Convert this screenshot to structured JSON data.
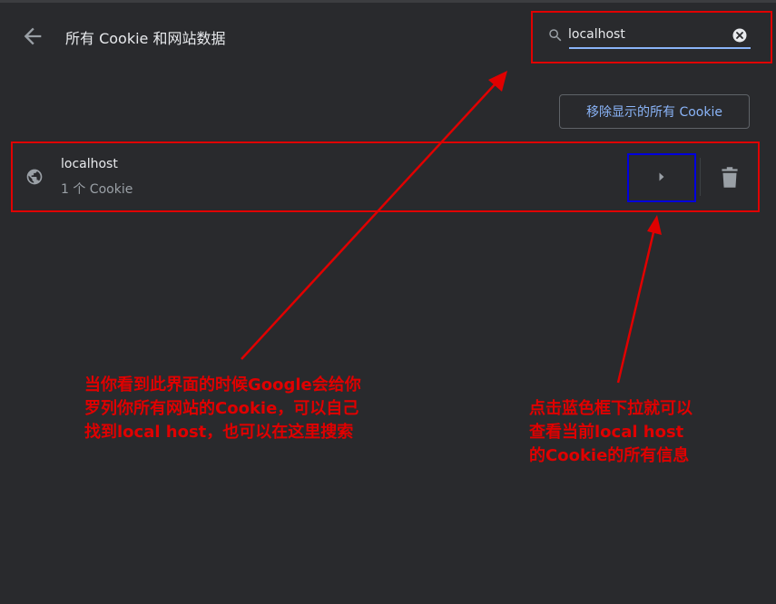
{
  "header": {
    "title": "所有 Cookie 和网站数据"
  },
  "search": {
    "value": "localhost"
  },
  "actions": {
    "remove_all_label": "移除显示的所有 Cookie"
  },
  "site": {
    "name": "localhost",
    "count": "1 个 Cookie"
  },
  "annotations": {
    "note_left": "当你看到此界面的时候Google会给你\n罗列你所有网站的Cookie，可以自己\n找到local host，也可以在这里搜索",
    "note_right": "点击蓝色框下拉就可以\n查看当前local host\n的Cookie的所有信息"
  },
  "colors": {
    "background": "#292a2d",
    "text_primary": "#e8eaed",
    "text_secondary": "#9aa0a6",
    "accent": "#8ab4f8",
    "annotation_red": "#e00000",
    "annotation_blue": "#0000dd"
  }
}
